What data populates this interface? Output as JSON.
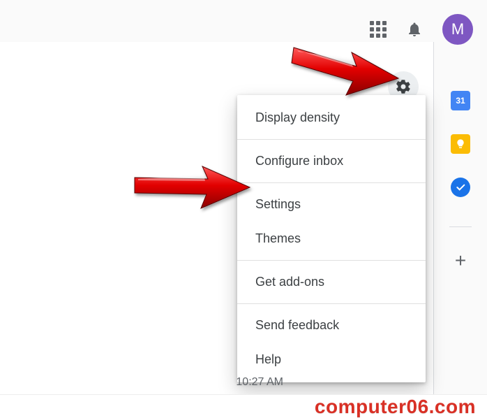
{
  "header": {
    "avatar_initial": "M"
  },
  "menu": {
    "items": [
      "Display density",
      "Configure inbox",
      "Settings",
      "Themes",
      "Get add-ons",
      "Send feedback",
      "Help"
    ]
  },
  "side": {
    "calendar_badge": "31"
  },
  "timestamp": "10:27 AM",
  "watermark": "computer06.com"
}
